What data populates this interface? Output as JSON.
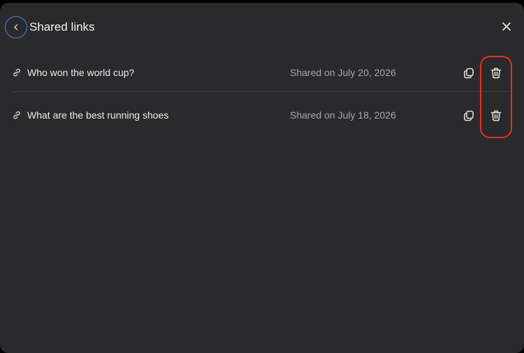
{
  "header": {
    "title": "Shared links",
    "back_icon": "chevron-left-icon",
    "close_icon": "close-icon"
  },
  "links": [
    {
      "title": "Who won the world cup?",
      "shared": "Shared on July 20, 2026",
      "icon": "link-icon",
      "copy_icon": "copy-icon",
      "delete_icon": "trash-icon"
    },
    {
      "title": "What are the best running shoes",
      "shared": "Shared on July 18, 2026",
      "icon": "link-icon",
      "copy_icon": "copy-icon",
      "delete_icon": "trash-icon"
    }
  ],
  "colors": {
    "background": "#2a2a2c",
    "text": "#ececec",
    "muted_text": "#a8a8aa",
    "back_button_ring": "#4f7fe6",
    "delete_highlight": "#e0311f"
  }
}
